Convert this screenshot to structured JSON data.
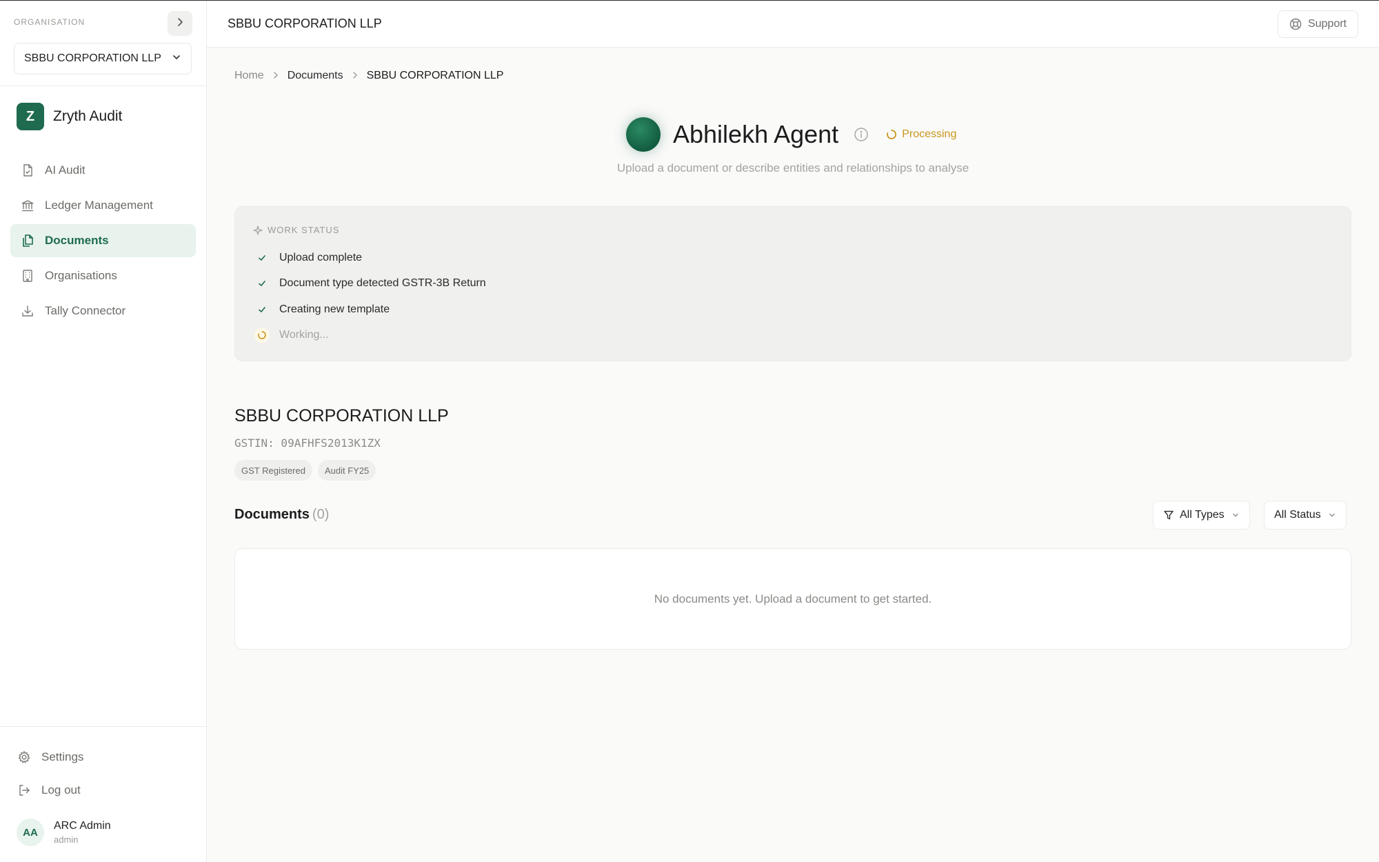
{
  "sidebar": {
    "org_label": "ORGANISATION",
    "org_selected": "SBBU CORPORATION LLP",
    "brand_initial": "Z",
    "brand_name": "Zryth Audit",
    "items": [
      {
        "label": "AI Audit",
        "icon": "file-check-icon",
        "active": false
      },
      {
        "label": "Ledger Management",
        "icon": "bank-icon",
        "active": false
      },
      {
        "label": "Documents",
        "icon": "documents-icon",
        "active": true
      },
      {
        "label": "Organisations",
        "icon": "building-icon",
        "active": false
      },
      {
        "label": "Tally Connector",
        "icon": "download-icon",
        "active": false
      }
    ],
    "settings_label": "Settings",
    "logout_label": "Log out",
    "user": {
      "initials": "AA",
      "name": "ARC Admin",
      "role": "admin"
    }
  },
  "header": {
    "title": "SBBU CORPORATION LLP",
    "support_label": "Support"
  },
  "breadcrumb": [
    "Home",
    "Documents",
    "SBBU CORPORATION LLP"
  ],
  "agent": {
    "name": "Abhilekh Agent",
    "status": "Processing",
    "subtitle": "Upload a document or describe entities and relationships to analyse"
  },
  "work_status": {
    "heading": "WORK STATUS",
    "steps": [
      {
        "label": "Upload complete",
        "state": "done"
      },
      {
        "label": "Document type detected GSTR-3B Return",
        "state": "done"
      },
      {
        "label": "Creating new template",
        "state": "done"
      },
      {
        "label": "Working...",
        "state": "pending"
      }
    ]
  },
  "company": {
    "name": "SBBU CORPORATION LLP",
    "gstin": "GSTIN: 09AFHFS2013K1ZX",
    "tags": [
      "GST Registered",
      "Audit FY25"
    ]
  },
  "documents": {
    "title": "Documents",
    "count": "(0)",
    "filter_types": "All Types",
    "filter_status": "All Status",
    "empty_message": "No documents yet. Upload a document to get started."
  },
  "colors": {
    "accent": "#1f6b4f",
    "accent_bg": "#e7f3ec",
    "processing": "#c9961c"
  }
}
